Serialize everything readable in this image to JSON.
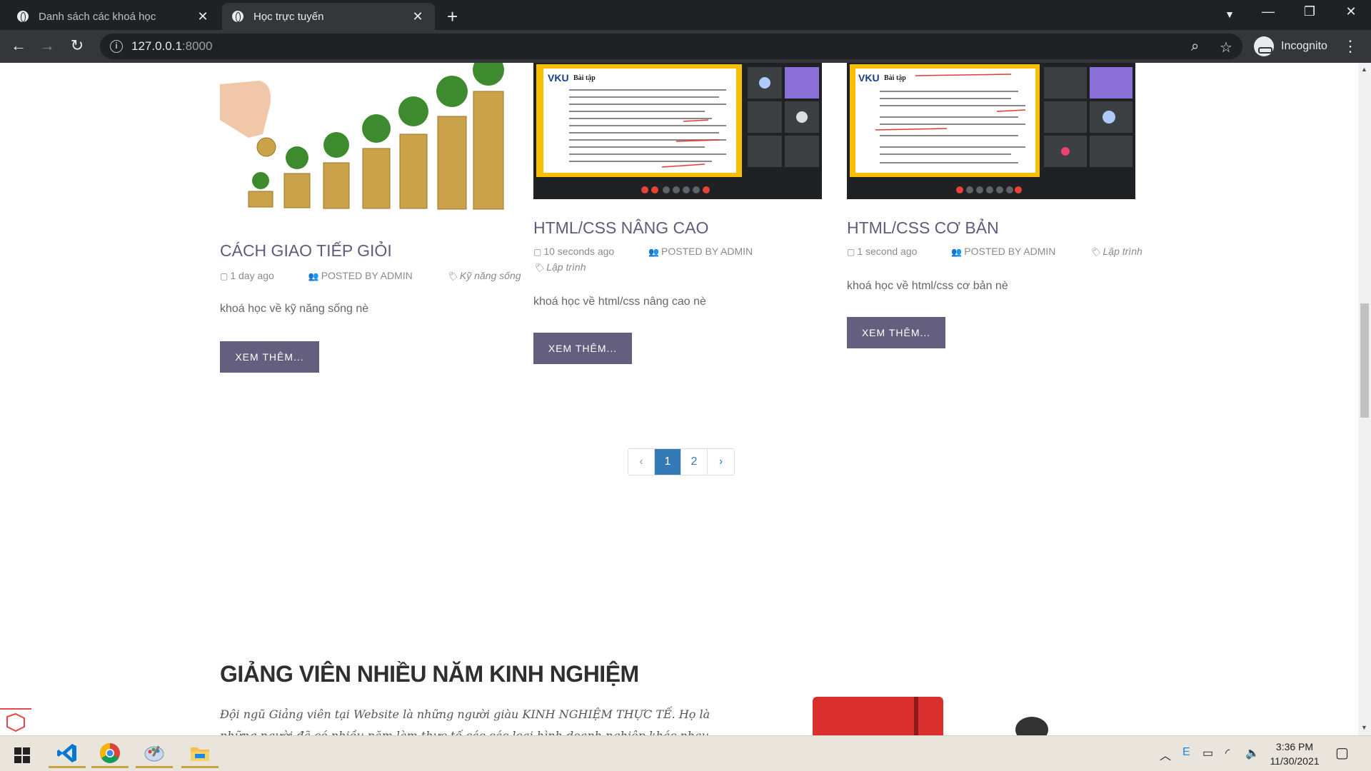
{
  "browser": {
    "tabs": [
      {
        "title": "Danh sách các khoá học",
        "active": false
      },
      {
        "title": "Học trực tuyến",
        "active": true
      }
    ],
    "url_host": "127.0.0.1",
    "url_port": ":8000",
    "incognito_label": "Incognito"
  },
  "courses": [
    {
      "title": "CÁCH GIAO TIẾP GIỎI",
      "time": "1 day ago",
      "author": "POSTED BY ADMIN",
      "category": "Kỹ năng sống",
      "excerpt": "khoá học về kỹ năng sống nè",
      "button": "XEM THÊM...",
      "image": "coins-and-trees"
    },
    {
      "title": "HTML/CSS NÂNG CAO",
      "time": "10 seconds ago",
      "author": "POSTED BY ADMIN",
      "category": "Lập trình",
      "excerpt": "khoá học về html/css nâng cao nè",
      "button": "XEM THÊM...",
      "image": "video-lesson-screenshot",
      "slide_logo": "VKU",
      "slide_title": "Bài tập"
    },
    {
      "title": "HTML/CSS CƠ BẢN",
      "time": "1 second ago",
      "author": "POSTED BY ADMIN",
      "category": "Lập trình",
      "excerpt": "khoá học về html/css cơ bản nè",
      "button": "XEM THÊM...",
      "image": "video-lesson-screenshot",
      "slide_logo": "VKU",
      "slide_title": "Bài tập"
    }
  ],
  "pagination": {
    "prev": "‹",
    "pages": [
      "1",
      "2"
    ],
    "current": "1",
    "next": "›"
  },
  "instructors": {
    "title": "GIẢNG VIÊN NHIỀU NĂM KINH NGHIỆM",
    "text": "Đội ngũ Giảng viên tại Website là những người giàu KINH NGHIỆM THỰC TẾ. Họ là những người đã có nhiều năm làm thực tế các các loại hình doanh nghiệp khác nhau, cùng với kỹ năng giảng"
  },
  "taskbar": {
    "apps": [
      "vscode-icon",
      "chrome-icon",
      "paint-icon",
      "file-explorer-icon"
    ],
    "time": "3:36 PM",
    "date": "11/30/2021"
  }
}
